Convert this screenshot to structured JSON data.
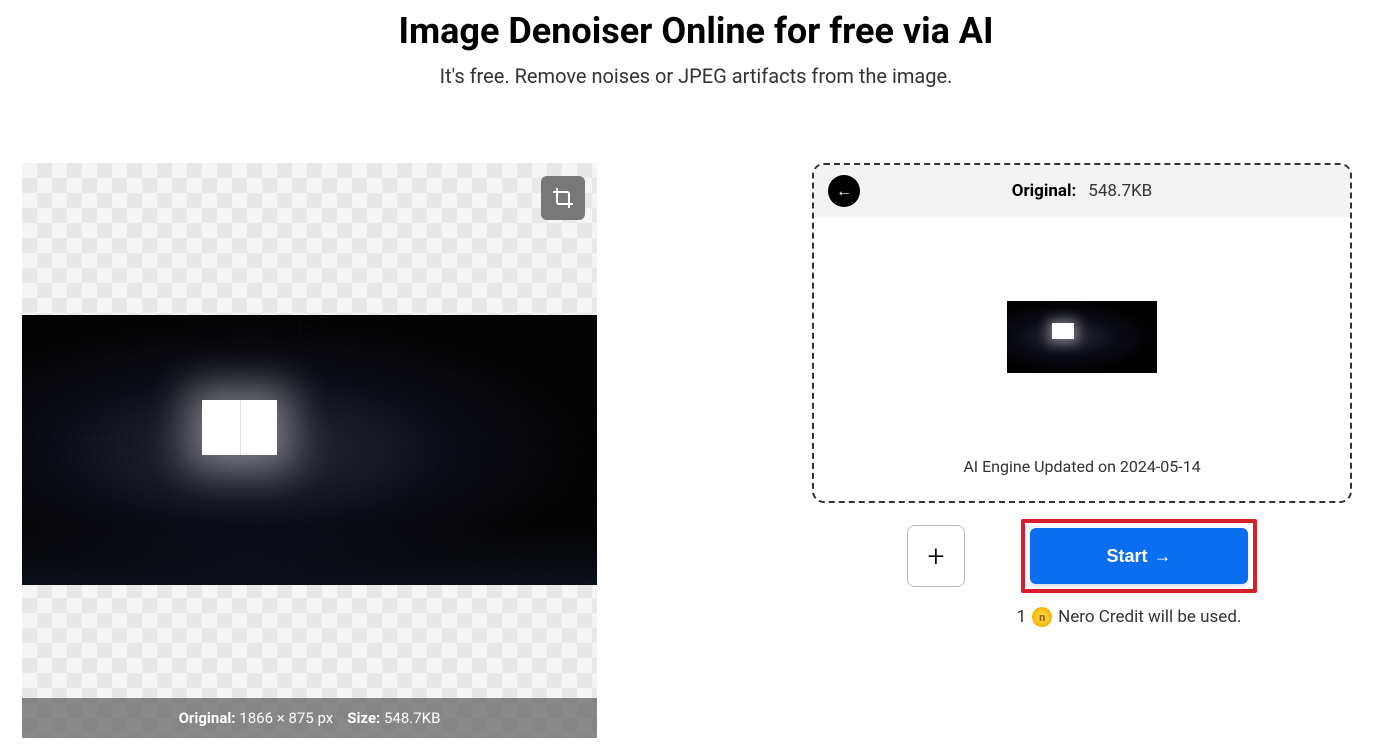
{
  "header": {
    "title": "Image Denoiser Online for free via AI",
    "subtitle": "It's free. Remove noises or JPEG artifacts from the image."
  },
  "preview": {
    "original_label": "Original:",
    "dimensions": "1866 × 875 px",
    "size_label": "Size:",
    "size_value": "548.7KB"
  },
  "panel": {
    "original_label": "Original:",
    "original_size": "548.7KB",
    "engine_text": "AI Engine Updated on 2024-05-14"
  },
  "actions": {
    "start_label": "Start",
    "start_arrow": "→",
    "credit_count": "1",
    "credit_text": "Nero Credit will be used.",
    "coin_char": "n"
  }
}
